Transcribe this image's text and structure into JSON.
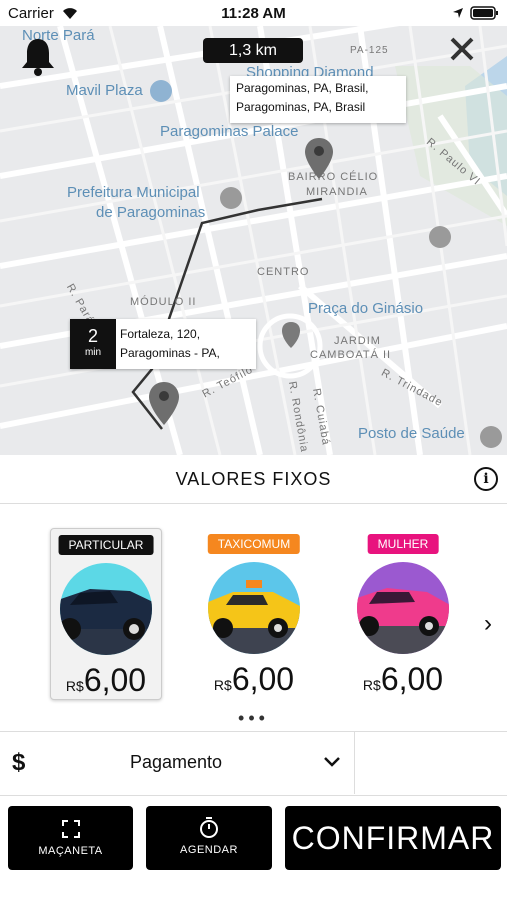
{
  "status": {
    "carrier": "Carrier",
    "time": "11:28 AM"
  },
  "map": {
    "distance": "1,3 km",
    "destination_line1": "Paragominas, PA, Brasil,",
    "destination_line2": "Paragominas, PA, Brasil",
    "eta_value": "2",
    "eta_unit": "min",
    "origin_line1": "Fortaleza, 120,",
    "origin_line2": "Paragominas - PA,",
    "places": {
      "norte_para": "Norte Pará",
      "shopping": "Shopping Diamond",
      "mavil": "Mavil Plaza",
      "palace": "Paragominas Palace",
      "prefeitura1": "Prefeitura Municipal",
      "prefeitura2": "de Paragominas",
      "praca": "Praça do Ginásio",
      "posto": "Posto de Saúde"
    },
    "areas": {
      "bairro1": "BAIRRO CÉLIO",
      "bairro2": "MIRANDIA",
      "centro": "CENTRO",
      "modulo": "MÓDULO II",
      "jardim1": "JARDIM",
      "jardim2": "CAMBOATÁ II"
    },
    "streets": {
      "pa125": "PA-125",
      "paulo_vi": "R. Paulo VI",
      "trindade": "R. Trindade",
      "teofilo": "R. Teófilo",
      "rondonia": "R. Rondônia",
      "cuiaba": "R. Cuiabá",
      "para": "R. Pará"
    }
  },
  "fixed": {
    "title": "VALORES FIXOS",
    "info_icon": "info-icon"
  },
  "vehicles": [
    {
      "label": "PARTICULAR",
      "currency": "R$",
      "price": "6,00",
      "color": "#111111",
      "selected": true
    },
    {
      "label": "TAXICOMUM",
      "currency": "R$",
      "price": "6,00",
      "color": "#f5871f",
      "selected": false
    },
    {
      "label": "MULHER",
      "currency": "R$",
      "price": "6,00",
      "color": "#e8137e",
      "selected": false
    }
  ],
  "pager": "•••",
  "payment": {
    "symbol": "$",
    "label": "Pagamento"
  },
  "buttons": {
    "macaneta": "MAÇANETA",
    "agendar": "AGENDAR",
    "confirmar": "CONFIRMAR"
  }
}
